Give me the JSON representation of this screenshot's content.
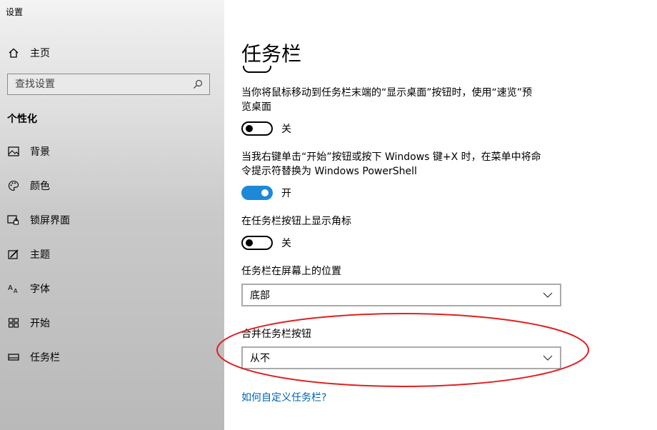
{
  "window": {
    "title": "设置"
  },
  "sidebar": {
    "home_label": "主页",
    "search_placeholder": "查找设置",
    "section_title": "个性化",
    "items": [
      {
        "label": "背景",
        "icon": "image-icon"
      },
      {
        "label": "颜色",
        "icon": "palette-icon"
      },
      {
        "label": "锁屏界面",
        "icon": "lock-screen-icon"
      },
      {
        "label": "主题",
        "icon": "theme-icon"
      },
      {
        "label": "字体",
        "icon": "font-icon"
      },
      {
        "label": "开始",
        "icon": "start-icon"
      },
      {
        "label": "任务栏",
        "icon": "taskbar-icon"
      }
    ]
  },
  "main": {
    "title": "任务栏",
    "settings": [
      {
        "text_line1": "当你将鼠标移动到任务栏末端的“显示桌面”按钮时，使用“速览”预",
        "text_line2": "览桌面",
        "state": "关",
        "on": false
      },
      {
        "text_line1": "当我右键单击“开始”按钮或按下 Windows 键+X 时，在菜单中将命",
        "text_line2": "令提示符替换为 Windows PowerShell",
        "state": "开",
        "on": true
      },
      {
        "text_line1": "在任务栏按钮上显示角标",
        "state": "关",
        "on": false
      }
    ],
    "position": {
      "label": "任务栏在屏幕上的位置",
      "value": "底部"
    },
    "combine": {
      "label": "合并任务栏按钮",
      "value": "从不"
    },
    "help_link": "如何自定义任务栏?"
  },
  "colors": {
    "accent": "#1e88d8",
    "link": "#0063b1",
    "annotation": "#e02020"
  }
}
